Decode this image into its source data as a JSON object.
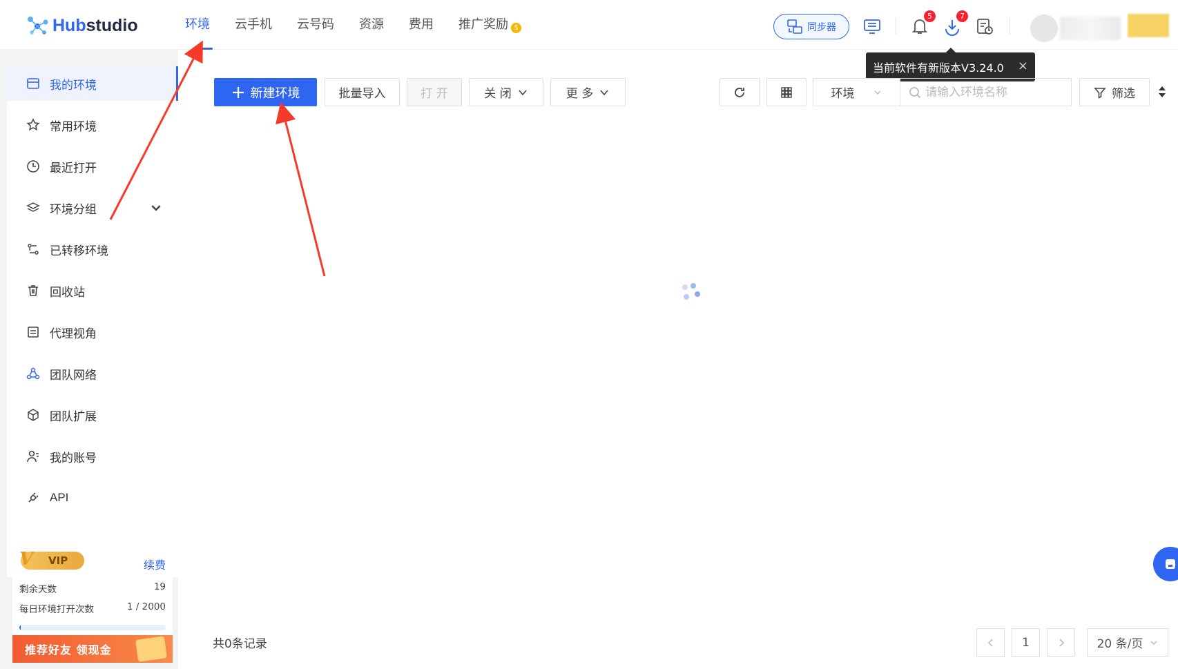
{
  "app": {
    "logo_text": "Hubstudio",
    "logo_prefix": "Hub",
    "logo_suffix": "studio"
  },
  "nav": {
    "items": [
      {
        "label": "环境",
        "active": true
      },
      {
        "label": "云手机"
      },
      {
        "label": "云号码"
      },
      {
        "label": "资源"
      },
      {
        "label": "费用"
      },
      {
        "label": "推广奖励"
      }
    ]
  },
  "header": {
    "sync_label": "同步器",
    "notification_count": "5",
    "download_count": "7",
    "accent": "#2f66f1"
  },
  "tooltip": {
    "text": "当前软件有新版本V3.24.0",
    "close": "×"
  },
  "sidebar": {
    "items": [
      {
        "label": "我的环境",
        "icon": "browser-icon",
        "active": true
      },
      {
        "label": "常用环境",
        "icon": "star-icon"
      },
      {
        "label": "最近打开",
        "icon": "clock-icon"
      },
      {
        "label": "环境分组",
        "icon": "layers-icon"
      },
      {
        "label": "已转移环境",
        "icon": "transfer-icon"
      },
      {
        "label": "回收站",
        "icon": "trash-icon"
      },
      {
        "label": "代理视角",
        "icon": "proxy-icon"
      },
      {
        "label": "团队网络",
        "icon": "team-network-icon"
      },
      {
        "label": "团队扩展",
        "icon": "cube-icon"
      },
      {
        "label": "我的账号",
        "icon": "user-icon"
      },
      {
        "label": "API",
        "icon": "plug-icon"
      }
    ]
  },
  "vip": {
    "badge": "VIP",
    "renew": "续费",
    "days_label": "剩余天数",
    "days_value": "19",
    "opens_label": "每日环境打开次数",
    "opens_value": "1 / 2000",
    "progress": 0.0005
  },
  "promo": {
    "label": "推荐好友 领现金"
  },
  "toolbar": {
    "new_env": "新建环境",
    "batch_import": "批量导入",
    "open": "打 开",
    "close": "关 闭",
    "more": "更 多",
    "env_select": "环境",
    "search_placeholder": "请输入环境名称",
    "filter": "筛选"
  },
  "footer": {
    "total": "共0条记录",
    "page": "1",
    "page_size": "20 条/页"
  }
}
